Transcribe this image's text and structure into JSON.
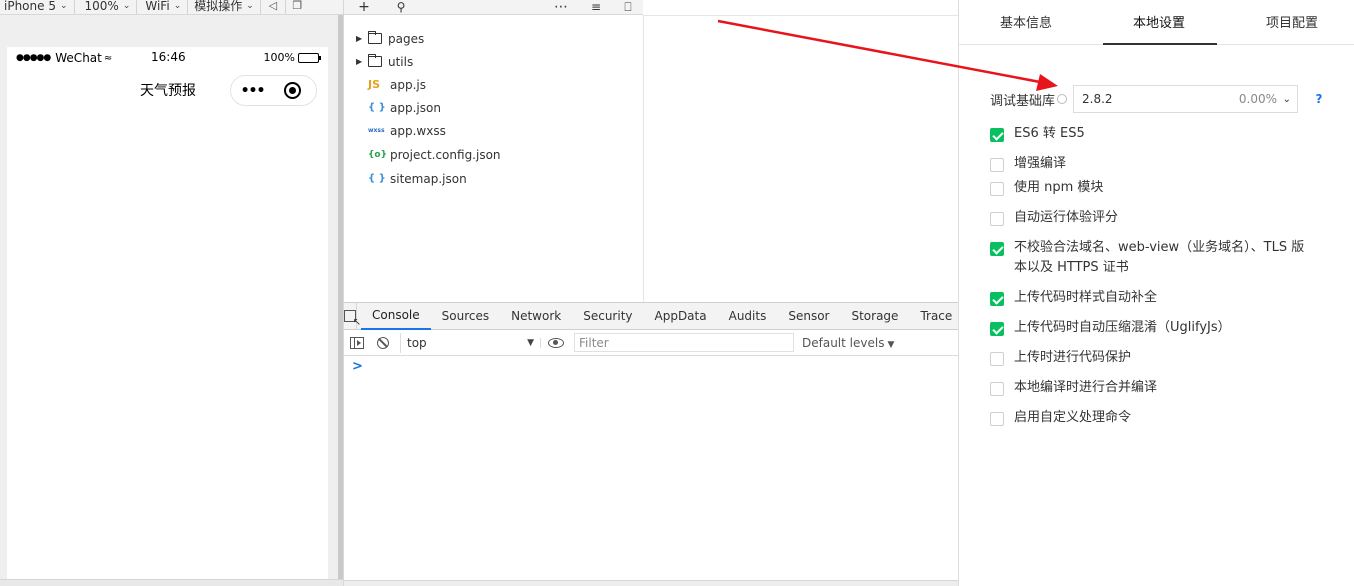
{
  "simulator": {
    "toolbar": {
      "device": "iPhone 5",
      "zoom": "100%",
      "network": "WiFi",
      "operation": "模拟操作"
    },
    "phone": {
      "signal": "●●●●●",
      "carrier": "WeChat",
      "time": "16:46",
      "battery": "100%",
      "nav_title": "天气预报",
      "capsule_more": "•••"
    }
  },
  "file_tree": {
    "items": [
      {
        "type": "folder",
        "name": "pages",
        "icon": "folder-icon"
      },
      {
        "type": "folder",
        "name": "utils",
        "icon": "folder-icon"
      },
      {
        "type": "file",
        "name": "app.js",
        "badge": "JS",
        "icon": "js-file-icon"
      },
      {
        "type": "file",
        "name": "app.json",
        "badge": "{ }",
        "icon": "json-file-icon"
      },
      {
        "type": "file",
        "name": "app.wxss",
        "badge": "wxss",
        "icon": "wxss-file-icon"
      },
      {
        "type": "file",
        "name": "project.config.json",
        "badge": "{o}",
        "icon": "config-file-icon"
      },
      {
        "type": "file",
        "name": "sitemap.json",
        "badge": "{ }",
        "icon": "json-file-icon"
      }
    ]
  },
  "devtools": {
    "tabs": [
      "Console",
      "Sources",
      "Network",
      "Security",
      "AppData",
      "Audits",
      "Sensor",
      "Storage",
      "Trace"
    ],
    "active_tab": "Console",
    "context": "top",
    "filter_placeholder": "Filter",
    "levels": "Default levels",
    "prompt": ">"
  },
  "settings": {
    "tabs": [
      "基本信息",
      "本地设置",
      "项目配置"
    ],
    "active_tab": "本地设置",
    "lib_label": "调试基础库",
    "lib_version": "2.8.2",
    "lib_percent": "0.00%",
    "help": "?",
    "options": [
      {
        "label": "ES6 转 ES5",
        "checked": true
      },
      {
        "label": "增强编译",
        "checked": false
      },
      {
        "label": "使用 npm 模块",
        "checked": false
      },
      {
        "label": "自动运行体验评分",
        "checked": false
      },
      {
        "label": "不校验合法域名、web-view（业务域名）、TLS 版本以及 HTTPS 证书",
        "checked": true
      },
      {
        "label": "上传代码时样式自动补全",
        "checked": true
      },
      {
        "label": "上传代码时自动压缩混淆（UglifyJs）",
        "checked": true
      },
      {
        "label": "上传时进行代码保护",
        "checked": false
      },
      {
        "label": "本地编译时进行合并编译",
        "checked": false
      },
      {
        "label": "启用自定义处理命令",
        "checked": false
      }
    ],
    "accent_color": "#07c160"
  },
  "annotation": {
    "color": "#e8141b"
  }
}
